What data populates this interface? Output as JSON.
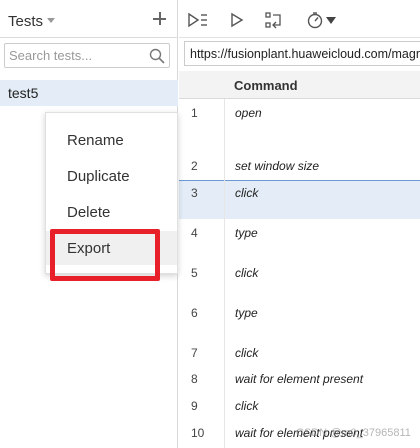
{
  "left_panel": {
    "title": "Tests",
    "search_placeholder": "Search tests...",
    "test_name": "test5"
  },
  "context_menu": {
    "items": [
      "Rename",
      "Duplicate",
      "Delete",
      "Export"
    ]
  },
  "url_bar": {
    "value": "https://fusionplant.huaweicloud.com/magno"
  },
  "table": {
    "column_header": "Command",
    "rows": [
      {
        "num": "1",
        "command": "open"
      },
      {
        "num": "2",
        "command": "set window size"
      },
      {
        "num": "3",
        "command": "click"
      },
      {
        "num": "4",
        "command": "type"
      },
      {
        "num": "5",
        "command": "click"
      },
      {
        "num": "6",
        "command": "type"
      },
      {
        "num": "7",
        "command": "click"
      },
      {
        "num": "8",
        "command": "wait for element present"
      },
      {
        "num": "9",
        "command": "click"
      },
      {
        "num": "10",
        "command": "wait for element present"
      }
    ]
  },
  "watermark": "CSDN @m0_37965811",
  "colors": {
    "selection": "#e4edf7",
    "highlight_border": "#e8202a",
    "menu_hover": "#f0f0f0"
  }
}
